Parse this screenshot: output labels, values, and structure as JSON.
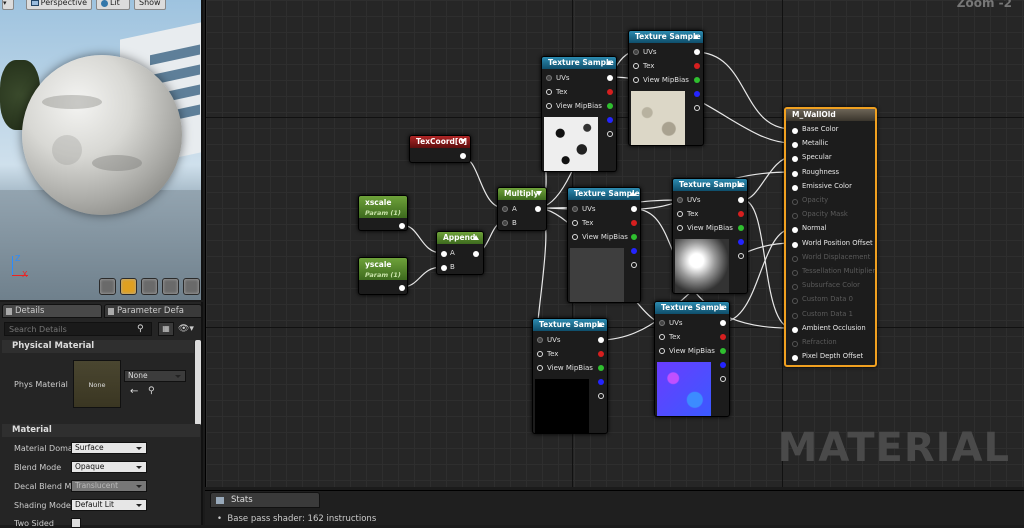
{
  "viewport": {
    "perspective_label": "Perspective",
    "lit_label": "Lit",
    "show_label": "Show",
    "axis_z": "Z",
    "axis_x": "X"
  },
  "details": {
    "tab_details": "Details",
    "tab_params": "Parameter Defa",
    "search_placeholder": "Search Details",
    "section_phys": "Physical Material",
    "phys_label": "Phys Material",
    "phys_thumb": "None",
    "phys_combo": "None",
    "section_material": "Material",
    "props": [
      {
        "label": "Material Doma",
        "value": "Surface"
      },
      {
        "label": "Blend Mode",
        "value": "Opaque"
      },
      {
        "label": "Decal Blend M",
        "value": "Translucent"
      },
      {
        "label": "Shading Model",
        "value": "Default Lit"
      },
      {
        "label": "Two Sided",
        "value": ""
      }
    ]
  },
  "graph": {
    "zoom": "Zoom -2",
    "watermark": "MATERIAL",
    "nodes": {
      "texcoord": "TexCoord[0]",
      "xscale": "xscale",
      "xscale_sub": "Param (1)",
      "yscale": "yscale",
      "yscale_sub": "Param (1)",
      "append": "Append",
      "multiply": "Multiply",
      "pin_a": "A",
      "pin_b": "B",
      "tex_title": "Texture Sample",
      "pin_uvs": "UVs",
      "pin_tex": "Tex",
      "pin_mip": "View MipBias",
      "result_title": "M_WallOld"
    },
    "result_pins": [
      {
        "label": "Base Color",
        "active": true
      },
      {
        "label": "Metallic",
        "active": true
      },
      {
        "label": "Specular",
        "active": true
      },
      {
        "label": "Roughness",
        "active": true
      },
      {
        "label": "Emissive Color",
        "active": true
      },
      {
        "label": "Opacity",
        "active": false
      },
      {
        "label": "Opacity Mask",
        "active": false
      },
      {
        "label": "Normal",
        "active": true
      },
      {
        "label": "World Position Offset",
        "active": true
      },
      {
        "label": "World Displacement",
        "active": false
      },
      {
        "label": "Tessellation Multiplier",
        "active": false
      },
      {
        "label": "Subsurface Color",
        "active": false
      },
      {
        "label": "Custom Data 0",
        "active": false
      },
      {
        "label": "Custom Data 1",
        "active": false
      },
      {
        "label": "Ambient Occlusion",
        "active": true
      },
      {
        "label": "Refraction",
        "active": false
      },
      {
        "label": "Pixel Depth Offset",
        "active": true
      }
    ]
  },
  "stats": {
    "tab": "Stats",
    "line": "Base pass shader: 162 instructions"
  }
}
